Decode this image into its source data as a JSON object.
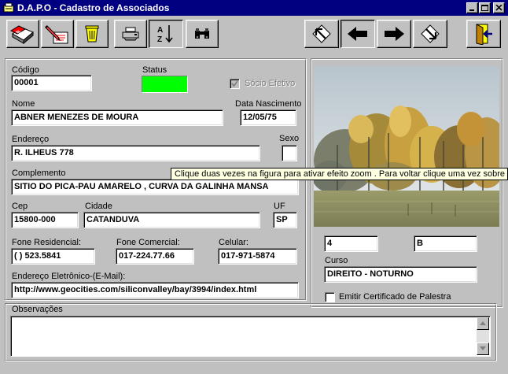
{
  "window": {
    "title": "D.A.P.O - Cadastro de Associados"
  },
  "toolbar": {
    "left_buttons": [
      "new-record-icon",
      "edit-record-icon",
      "trash-icon",
      "print-icon",
      "sort-az-icon",
      "binoculars-icon"
    ],
    "nav_buttons": [
      "first-record-icon",
      "previous-record-icon",
      "next-record-icon",
      "last-record-icon",
      "exit-icon"
    ],
    "sort_label": "A Z"
  },
  "form": {
    "codigo": {
      "label": "Código",
      "value": "00001"
    },
    "status": {
      "label": "Status",
      "color": "#00ff00"
    },
    "socio_efetivo": {
      "label": "Sócio Efetivo",
      "checked": true
    },
    "nome": {
      "label": "Nome",
      "value": "ABNER MENEZES DE MOURA"
    },
    "data_nascimento": {
      "label": "Data Nascimento",
      "value": "12/05/75"
    },
    "endereco": {
      "label": "Endereço",
      "value": "R. ILHEUS 778"
    },
    "sexo": {
      "label": "Sexo",
      "value": ""
    },
    "complemento": {
      "label": "Complemento",
      "value": "SITIO DO PICA-PAU AMARELO , CURVA DA GALINHA MANSA"
    },
    "cep": {
      "label": "Cep",
      "value": "15800-000"
    },
    "cidade": {
      "label": "Cidade",
      "value": "CATANDUVA"
    },
    "uf": {
      "label": "UF",
      "value": "SP"
    },
    "fone_residencial": {
      "label": "Fone Residencial:",
      "value": "(    ) 523.5841"
    },
    "fone_comercial": {
      "label": "Fone Comercial:",
      "value": "017-224.77.66"
    },
    "celular": {
      "label": "Celular:",
      "value": "017-971-5874"
    },
    "email": {
      "label": "Endereço Eletrônico-(E-Mail):",
      "value": "http://www.geocities.com/siliconvalley/bay/3994/index.html"
    },
    "observacoes": {
      "label": "Observações",
      "value": ""
    }
  },
  "right_panel": {
    "field_a": "4",
    "field_b": "B",
    "curso": {
      "label": "Curso",
      "value": "DIREITO - NOTURNO"
    },
    "emitir_certificado": {
      "label": "Emitir Certificado de Palestra",
      "checked": false
    }
  },
  "tooltip": "Clique duas vezes na figura para ativar efeito zoom . Para voltar clique uma vez sobre a figura"
}
